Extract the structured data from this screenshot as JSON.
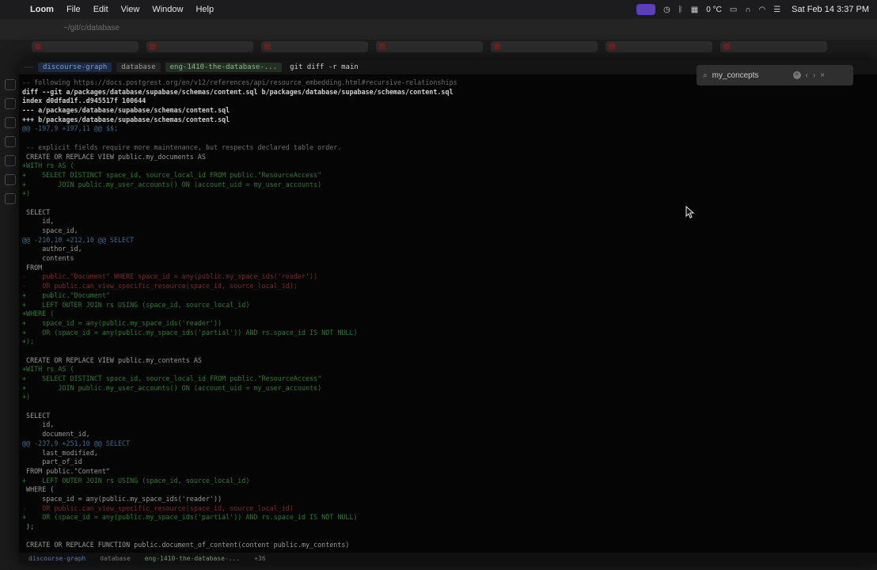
{
  "menubar": {
    "items": [
      "Loom",
      "File",
      "Edit",
      "View",
      "Window",
      "Help"
    ],
    "temperature": "0 °C",
    "clock": "Sat Feb 14  3:37 PM"
  },
  "browser": {
    "address": "~/git/c/database"
  },
  "terminal": {
    "prompt": {
      "dir": "discourse-graph",
      "sub": "database",
      "branch": "eng-1410-the-database-...",
      "git_cmd": "git diff -r main"
    },
    "lines": [
      {
        "cls": "cm",
        "text": "-- following https://docs.postgrest.org/en/v12/references/api/resource_embedding.html#recursive-relationships"
      },
      {
        "cls": "hdr",
        "text": "diff --git a/packages/database/supabase/schemas/content.sql b/packages/database/supabase/schemas/content.sql"
      },
      {
        "cls": "hdr",
        "text": "index d0dfad1f..d945517f 100644"
      },
      {
        "cls": "hdr",
        "text": "--- a/packages/database/supabase/schemas/content.sql"
      },
      {
        "cls": "hdr",
        "text": "+++ b/packages/database/supabase/schemas/content.sql"
      },
      {
        "cls": "hunk",
        "text": "@@ -197,9 +197,11 @@ $$;"
      },
      {
        "cls": "ctx",
        "text": ""
      },
      {
        "cls": "cm",
        "text": " -- explicit fields require more maintenance, but respects declared table order."
      },
      {
        "cls": "ctx",
        "text": " CREATE OR REPLACE VIEW public.my_documents AS"
      },
      {
        "cls": "add",
        "text": "+WITH rs AS ("
      },
      {
        "cls": "add",
        "text": "+    SELECT DISTINCT space_id, source_local_id FROM public.\"ResourceAccess\""
      },
      {
        "cls": "add",
        "text": "+        JOIN public.my_user_accounts() ON (account_uid = my_user_accounts)"
      },
      {
        "cls": "add",
        "text": "+)"
      },
      {
        "cls": "ctx",
        "text": " "
      },
      {
        "cls": "ctx",
        "text": " SELECT"
      },
      {
        "cls": "ctx",
        "text": "     id,"
      },
      {
        "cls": "ctx",
        "text": "     space_id,"
      },
      {
        "cls": "hunk",
        "text": "@@ -210,10 +212,10 @@ SELECT"
      },
      {
        "cls": "ctx",
        "text": "     author_id,"
      },
      {
        "cls": "ctx",
        "text": "     contents"
      },
      {
        "cls": "ctx",
        "text": " FROM"
      },
      {
        "cls": "del",
        "text": "-    public.\"Document\" WHERE space_id = any(public.my_space_ids('reader'))"
      },
      {
        "cls": "del",
        "text": "-    OR public.can_view_specific_resource(space_id, source_local_id);"
      },
      {
        "cls": "add",
        "text": "+    public.\"Document\""
      },
      {
        "cls": "add",
        "text": "+    LEFT OUTER JOIN rs USING (space_id, source_local_id)"
      },
      {
        "cls": "add",
        "text": "+WHERE ("
      },
      {
        "cls": "add",
        "text": "+    space_id = any(public.my_space_ids('reader'))"
      },
      {
        "cls": "add",
        "text": "+    OR (space_id = any(public.my_space_ids('partial')) AND rs.space_id IS NOT NULL)"
      },
      {
        "cls": "add",
        "text": "+);"
      },
      {
        "cls": "ctx",
        "text": ""
      },
      {
        "cls": "ctx",
        "text": " CREATE OR REPLACE VIEW public.my_contents AS"
      },
      {
        "cls": "add",
        "text": "+WITH rs AS ("
      },
      {
        "cls": "add",
        "text": "+    SELECT DISTINCT space_id, source_local_id FROM public.\"ResourceAccess\""
      },
      {
        "cls": "add",
        "text": "+        JOIN public.my_user_accounts() ON (account_uid = my_user_accounts)"
      },
      {
        "cls": "add",
        "text": "+)"
      },
      {
        "cls": "ctx",
        "text": " "
      },
      {
        "cls": "ctx",
        "text": " SELECT"
      },
      {
        "cls": "ctx",
        "text": "     id,"
      },
      {
        "cls": "ctx",
        "text": "     document_id,"
      },
      {
        "cls": "hunk",
        "text": "@@ -237,9 +251,10 @@ SELECT"
      },
      {
        "cls": "ctx",
        "text": "     last_modified,"
      },
      {
        "cls": "ctx",
        "text": "     part_of_id"
      },
      {
        "cls": "ctx",
        "text": " FROM public.\"Content\""
      },
      {
        "cls": "add",
        "text": "+    LEFT OUTER JOIN rs USING (space_id, source_local_id)"
      },
      {
        "cls": "ctx",
        "text": " WHERE ("
      },
      {
        "cls": "ctx",
        "text": "     space_id = any(public.my_space_ids('reader'))"
      },
      {
        "cls": "del",
        "text": "-    OR public.can_view_specific_resource(space_id, source_local_id)"
      },
      {
        "cls": "add",
        "text": "+    OR (space_id = any(public.my_space_ids('partial')) AND rs.space_id IS NOT NULL)"
      },
      {
        "cls": "ctx",
        "text": " );"
      },
      {
        "cls": "ctx",
        "text": ""
      },
      {
        "cls": "ctx",
        "text": " CREATE OR REPLACE FUNCTION public.document_of_content(content public.my_contents)"
      }
    ]
  },
  "find": {
    "query": "my_concepts"
  },
  "statusbar": {
    "dir": "discourse-graph",
    "sub": "database",
    "branch": "eng-1410-the-database-...",
    "count": "+36"
  },
  "colors": {
    "accent": "#5b3fb8",
    "add": "#2f7a33",
    "del": "#7a2a2a",
    "hunk": "#3c6b8a"
  }
}
